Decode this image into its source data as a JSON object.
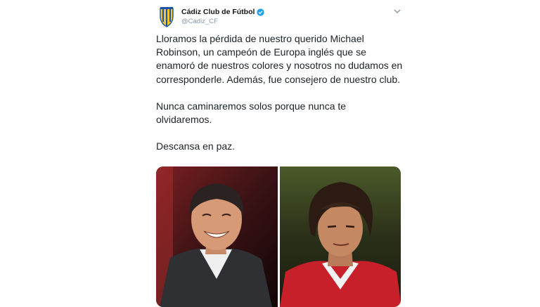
{
  "author": {
    "name": "Cádiz Club de Fútbol",
    "handle": "@Cadiz_CF",
    "verified": true,
    "avatar_icon": "club-crest-icon",
    "crest_colors": [
      "#f4c430",
      "#1d55a5"
    ]
  },
  "tweet": {
    "paragraphs": [
      "Lloramos la pérdida de nuestro querido Michael Robinson, un campeón de Europa inglés que se enamoró de nuestros colores y nosotros no dudamos en corresponderle. Además, fue consejero de nuestro club.",
      "Nunca caminaremos solos porque nunca te olvidaremos.",
      "Descansa en paz."
    ]
  },
  "media": {
    "images": [
      {
        "name": "photo-man-suit",
        "background": "#5a1a1c"
      },
      {
        "name": "photo-player-red-kit",
        "background": "#2f3b1e"
      }
    ]
  },
  "colors": {
    "text": "#1c2226",
    "secondary": "#8899a6",
    "verified": "#1da1f2"
  }
}
